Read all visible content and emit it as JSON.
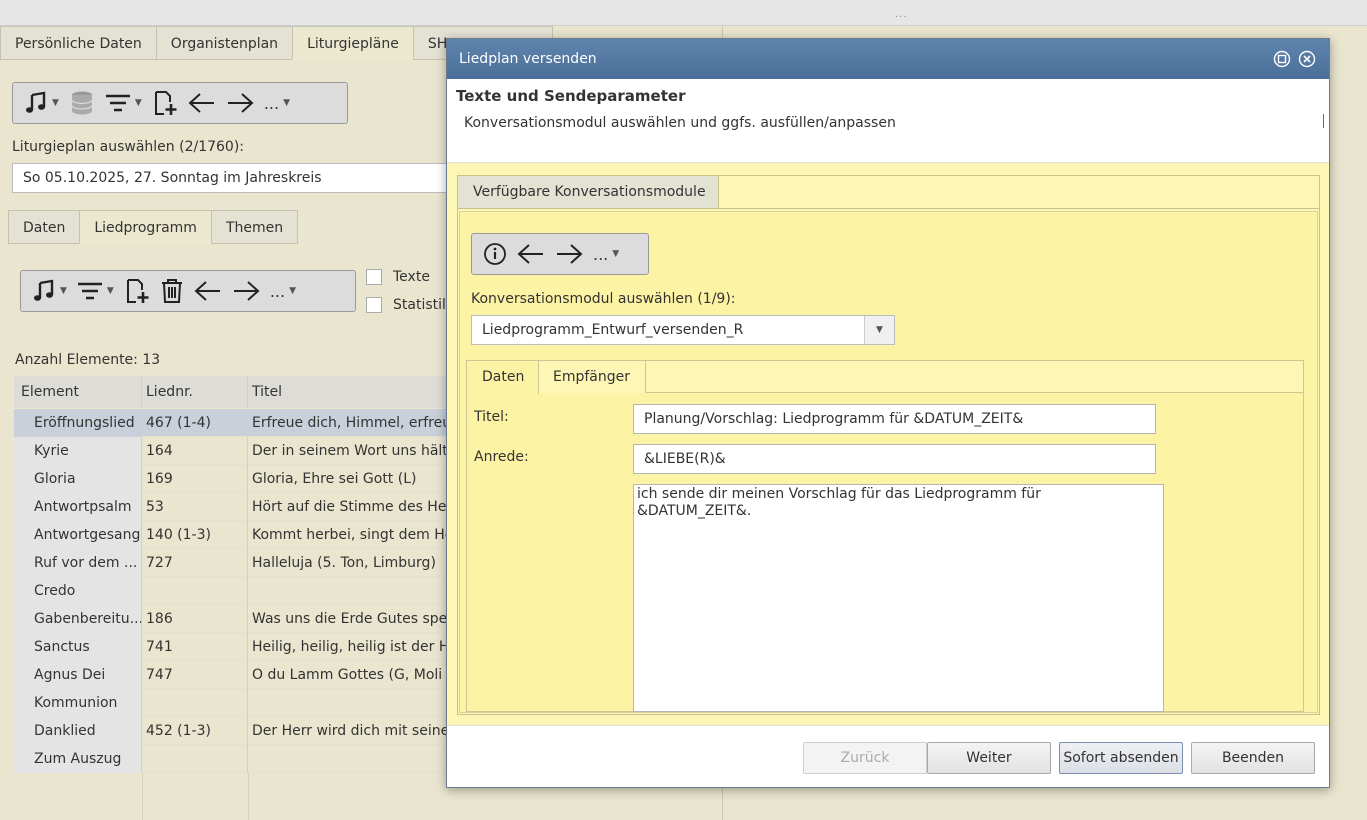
{
  "app": {
    "tabs": [
      "Persönliche Daten",
      "Organistenplan",
      "Liturgiepläne",
      "SH"
    ],
    "active_tab": "Liturgiepläne",
    "select_label": "Liturgieplan auswählen (2/1760):",
    "selected_plan": "So 05.10.2025, 27. Sonntag im Jahreskreis",
    "subtabs": [
      "Daten",
      "Liedprogramm",
      "Themen"
    ],
    "active_subtab": "Liedprogramm",
    "checkbox_texte": "Texte",
    "checkbox_statistik": "Statistil",
    "count_label": "Anzahl Elemente: 13",
    "toolbar_more": "...",
    "grid": {
      "headers": [
        "Element",
        "Liednr.",
        "Titel"
      ],
      "rows": [
        {
          "element": "Eröffnungslied",
          "nr": "467 (1-4)",
          "titel": "Erfreue dich, Himmel, erfreu"
        },
        {
          "element": "Kyrie",
          "nr": "164",
          "titel": "Der in seinem Wort uns hält"
        },
        {
          "element": "Gloria",
          "nr": "169",
          "titel": "Gloria, Ehre sei Gott (L)"
        },
        {
          "element": "Antwortpsalm",
          "nr": "53",
          "titel": "Hört auf die Stimme des Her"
        },
        {
          "element": "Antwortgesang",
          "nr": "140 (1-3)",
          "titel": "Kommt herbei, singt dem He"
        },
        {
          "element": "Ruf vor dem ...",
          "nr": "727",
          "titel": "Halleluja (5. Ton, Limburg)"
        },
        {
          "element": "Credo",
          "nr": "",
          "titel": ""
        },
        {
          "element": "Gabenbereitu...",
          "nr": "186",
          "titel": "Was uns die Erde Gutes spe"
        },
        {
          "element": "Sanctus",
          "nr": "741",
          "titel": "Heilig, heilig, heilig ist der H"
        },
        {
          "element": "Agnus Dei",
          "nr": "747",
          "titel": "O du Lamm Gottes (G, Moli"
        },
        {
          "element": "Kommunion",
          "nr": "",
          "titel": ""
        },
        {
          "element": "Danklied",
          "nr": "452 (1-3)",
          "titel": "Der Herr wird dich mit seine"
        },
        {
          "element": "Zum Auszug",
          "nr": "",
          "titel": ""
        }
      ]
    }
  },
  "dialog": {
    "title": "Liedplan versenden",
    "heading": "Texte und Sendeparameter",
    "subheading": "Konversationsmodul auswählen und ggfs. ausfüllen/anpassen",
    "panel_tab": "Verfügbare Konversationsmodule",
    "more_label": "...",
    "module_label": "Konversationsmodul auswählen (1/9):",
    "module_selected": "Liedprogramm_Entwurf_versenden_R",
    "inner_tabs": [
      "Daten",
      "Empfänger"
    ],
    "titel_label": "Titel:",
    "titel_value": "Planung/Vorschlag: Liedprogramm für &DATUM_ZEIT&",
    "anrede_label": "Anrede:",
    "anrede_value": "&LIEBE(R)&",
    "body_text": "ich sende dir meinen Vorschlag für das Liedprogramm für\n&DATUM_ZEIT&.",
    "buttons": {
      "back": "Zurück",
      "next": "Weiter",
      "send_now": "Sofort absenden",
      "close": "Beenden"
    }
  }
}
